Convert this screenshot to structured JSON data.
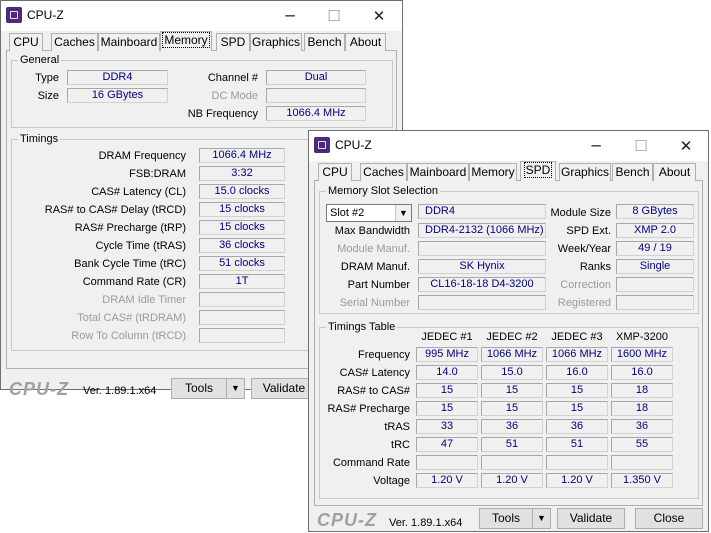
{
  "back": {
    "title": "CPU-Z",
    "controls": {
      "minimize": "─",
      "maximize": "☐",
      "close": "✕"
    },
    "tabs": [
      "CPU",
      "Caches",
      "Mainboard",
      "Memory",
      "SPD",
      "Graphics",
      "Bench",
      "About"
    ],
    "active_tab": "Memory",
    "general": {
      "title": "General",
      "type_label": "Type",
      "type_value": "DDR4",
      "size_label": "Size",
      "size_value": "16 GBytes",
      "channel_label": "Channel #",
      "channel_value": "Dual",
      "dcmode_label": "DC Mode",
      "dcmode_value": "",
      "nbfreq_label": "NB Frequency",
      "nbfreq_value": "1066.4 MHz"
    },
    "timings": {
      "title": "Timings",
      "rows": [
        {
          "label": "DRAM Frequency",
          "value": "1066.4 MHz",
          "dim": false
        },
        {
          "label": "FSB:DRAM",
          "value": "3:32",
          "dim": false
        },
        {
          "label": "CAS# Latency (CL)",
          "value": "15.0 clocks",
          "dim": false
        },
        {
          "label": "RAS# to CAS# Delay (tRCD)",
          "value": "15 clocks",
          "dim": false
        },
        {
          "label": "RAS# Precharge (tRP)",
          "value": "15 clocks",
          "dim": false
        },
        {
          "label": "Cycle Time (tRAS)",
          "value": "36 clocks",
          "dim": false
        },
        {
          "label": "Bank Cycle Time (tRC)",
          "value": "51 clocks",
          "dim": false
        },
        {
          "label": "Command Rate (CR)",
          "value": "1T",
          "dim": false
        },
        {
          "label": "DRAM Idle Timer",
          "value": "",
          "dim": true
        },
        {
          "label": "Total CAS# (tRDRAM)",
          "value": "",
          "dim": true
        },
        {
          "label": "Row To Column (tRCD)",
          "value": "",
          "dim": true
        }
      ]
    },
    "footer": {
      "logo": "CPU-Z",
      "version": "Ver. 1.89.1.x64",
      "tools": "Tools",
      "validate": "Validate",
      "arrow": "▼"
    }
  },
  "front": {
    "title": "CPU-Z",
    "controls": {
      "minimize": "─",
      "maximize": "☐",
      "close": "✕"
    },
    "tabs": [
      "CPU",
      "Caches",
      "Mainboard",
      "Memory",
      "SPD",
      "Graphics",
      "Bench",
      "About"
    ],
    "active_tab": "SPD",
    "slot": {
      "title": "Memory Slot Selection",
      "slot_select": "Slot #2",
      "mem_type": "DDR4",
      "module_size_label": "Module Size",
      "module_size_value": "8 GBytes",
      "max_bw_label": "Max Bandwidth",
      "max_bw_value": "DDR4-2132 (1066 MHz)",
      "spd_ext_label": "SPD Ext.",
      "spd_ext_value": "XMP 2.0",
      "module_manuf_label": "Module Manuf.",
      "module_manuf_value": "",
      "week_year_label": "Week/Year",
      "week_year_value": "49 / 19",
      "dram_manuf_label": "DRAM Manuf.",
      "dram_manuf_value": "SK Hynix",
      "ranks_label": "Ranks",
      "ranks_value": "Single",
      "part_number_label": "Part Number",
      "part_number_value": "CL16-18-18 D4-3200",
      "correction_label": "Correction",
      "correction_value": "",
      "serial_label": "Serial Number",
      "serial_value": "",
      "registered_label": "Registered",
      "registered_value": ""
    },
    "timings_table": {
      "title": "Timings Table",
      "columns": [
        "JEDEC #1",
        "JEDEC #2",
        "JEDEC #3",
        "XMP-3200"
      ],
      "rows": [
        {
          "label": "Frequency",
          "values": [
            "995 MHz",
            "1066 MHz",
            "1066 MHz",
            "1600 MHz"
          ]
        },
        {
          "label": "CAS# Latency",
          "values": [
            "14.0",
            "15.0",
            "16.0",
            "16.0"
          ]
        },
        {
          "label": "RAS# to CAS#",
          "values": [
            "15",
            "15",
            "15",
            "18"
          ]
        },
        {
          "label": "RAS# Precharge",
          "values": [
            "15",
            "15",
            "15",
            "18"
          ]
        },
        {
          "label": "tRAS",
          "values": [
            "33",
            "36",
            "36",
            "36"
          ]
        },
        {
          "label": "tRC",
          "values": [
            "47",
            "51",
            "51",
            "55"
          ]
        },
        {
          "label": "Command Rate",
          "values": [
            "",
            "",
            "",
            ""
          ]
        },
        {
          "label": "Voltage",
          "values": [
            "1.20 V",
            "1.20 V",
            "1.20 V",
            "1.350 V"
          ]
        }
      ]
    },
    "footer": {
      "logo": "CPU-Z",
      "version": "Ver. 1.89.1.x64",
      "tools": "Tools",
      "validate": "Validate",
      "close": "Close",
      "arrow": "▼"
    }
  },
  "colors": {
    "value_text": "#000080",
    "app_icon": "#4b2a7b",
    "window_bg": "#f0f0f0"
  }
}
